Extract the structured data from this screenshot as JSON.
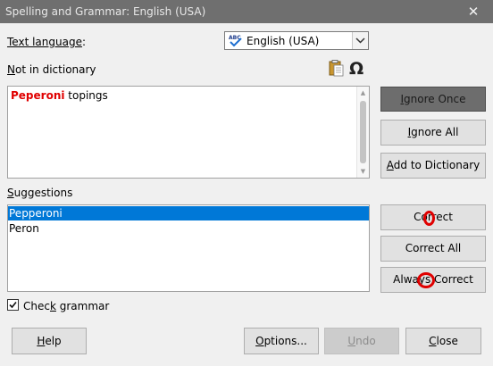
{
  "window": {
    "title": "Spelling and Grammar: English (USA)",
    "close_glyph": "✕"
  },
  "text_language": {
    "label_accel": "Text language",
    "label_rest": ":",
    "value": "English (USA)"
  },
  "not_in_dictionary": {
    "label_accel": "N",
    "label_rest": "ot in dictionary",
    "misspelled_word": "Peperoni",
    "rest_text": " topings"
  },
  "suggestions": {
    "label_accel": "S",
    "label_rest": "uggestions",
    "items": [
      "Pepperoni",
      "Peron"
    ],
    "selected_index": 0
  },
  "check_grammar": {
    "label_pre": "Chec",
    "label_accel": "k",
    "label_post": " grammar",
    "checked": true
  },
  "buttons": {
    "ignore_once_accel": "I",
    "ignore_once_rest": "gnore Once",
    "ignore_all_accel": "I",
    "ignore_all_rest": "gnore All",
    "add_pre": "A",
    "add_rest": "dd to Dictionary",
    "correct": "Correct",
    "correct_all": "Correct All",
    "always_correct": "Always Correct",
    "help_accel": "H",
    "help_rest": "elp",
    "options_accel": "O",
    "options_rest": "ptions...",
    "undo_accel": "U",
    "undo_rest": "ndo",
    "close_accel": "C",
    "close_rest": "lose"
  },
  "icons": {
    "language": "abc-checkmark-icon",
    "paste": "clipboard-icon",
    "special_char": "omega-icon"
  },
  "colors": {
    "titlebar": "#6f6f6f",
    "selection": "#0078d7",
    "misspelled": "#e00000",
    "annotation_marker": "#e00000"
  }
}
